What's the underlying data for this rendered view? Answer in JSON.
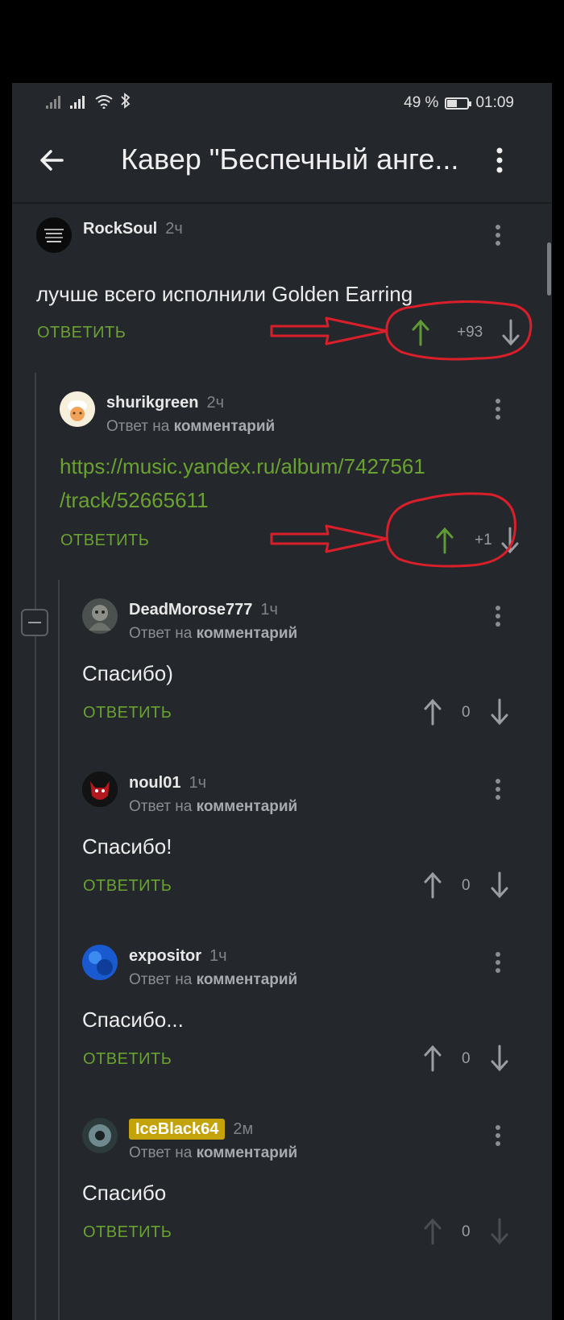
{
  "status_bar": {
    "battery": "49 %",
    "time": "01:09",
    "battery_level": 0.49
  },
  "header": {
    "title": "Кавер \"Беспечный анге..."
  },
  "comments": [
    {
      "user": "RockSoul",
      "time": "2ч",
      "text": "лучше всего исполнили Golden Earring",
      "reply": "ОТВЕТИТЬ",
      "rating": "+93"
    },
    {
      "user": "shurikgreen",
      "time": "2ч",
      "reply_prefix": "Ответ на",
      "reply_target": "комментарий",
      "link_line1": "https://music.yandex.ru/album/7427561",
      "link_line2": "/track/52665611",
      "reply": "ОТВЕТИТЬ",
      "rating": "+1"
    },
    {
      "user": "DeadMorose777",
      "time": "1ч",
      "reply_prefix": "Ответ на",
      "reply_target": "комментарий",
      "text": "Спасибо)",
      "reply": "ОТВЕТИТЬ",
      "rating": "0"
    },
    {
      "user": "noul01",
      "time": "1ч",
      "reply_prefix": "Ответ на",
      "reply_target": "комментарий",
      "text": "Спасибо!",
      "reply": "ОТВЕТИТЬ",
      "rating": "0"
    },
    {
      "user": "expositor",
      "time": "1ч",
      "reply_prefix": "Ответ на",
      "reply_target": "комментарий",
      "text": "Спасибо...",
      "reply": "ОТВЕТИТЬ",
      "rating": "0"
    },
    {
      "user": "IceBlack64",
      "time": "2м",
      "reply_prefix": "Ответ на",
      "reply_target": "комментарий",
      "text": "Спасибо",
      "reply": "ОТВЕТИТЬ",
      "rating": "0"
    }
  ],
  "colors": {
    "background": "#24272c",
    "accent_green": "#6aa232",
    "upvoted": "#5f9a35",
    "annotation_red": "#d9202a",
    "badge": "#c4a20a"
  }
}
